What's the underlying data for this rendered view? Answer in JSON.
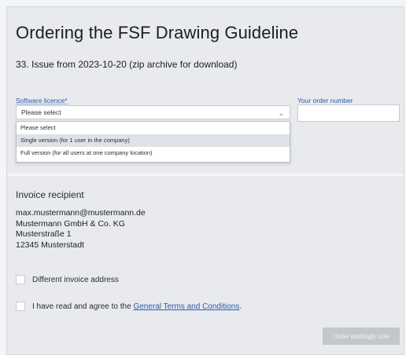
{
  "header": {
    "title": "Ordering the FSF Drawing Guideline",
    "subtitle": "33. Issue from 2023-10-20 (zip archive for download)"
  },
  "form": {
    "licence_label": "Software licence*",
    "licence_selected": "Please select",
    "licence_options": [
      "Please select",
      "Single version (for 1 user in the company)",
      "Full version (for all users at one company location)"
    ],
    "highlighted_option_index": 1,
    "order_number_label": "Your order number",
    "order_number_value": ""
  },
  "invoice": {
    "heading": "Invoice recipient",
    "lines": [
      "max.mustermann@mustermann.de",
      "Mustermann GmbH & Co. KG",
      "Musterstraße 1",
      "12345 Musterstadt"
    ]
  },
  "checkboxes": {
    "different_address_label": "Different invoice address",
    "terms_prefix": "I have read and agree to the ",
    "terms_link": "General Terms and Conditions",
    "terms_suffix": "."
  },
  "actions": {
    "order_button": "Order bindingly now"
  },
  "colors": {
    "label_blue": "#2b5aa8",
    "panel_gray": "#e8eaed",
    "button_disabled": "#c3c7cc"
  },
  "icons": {
    "select_chevron": "chevron-down-icon"
  }
}
